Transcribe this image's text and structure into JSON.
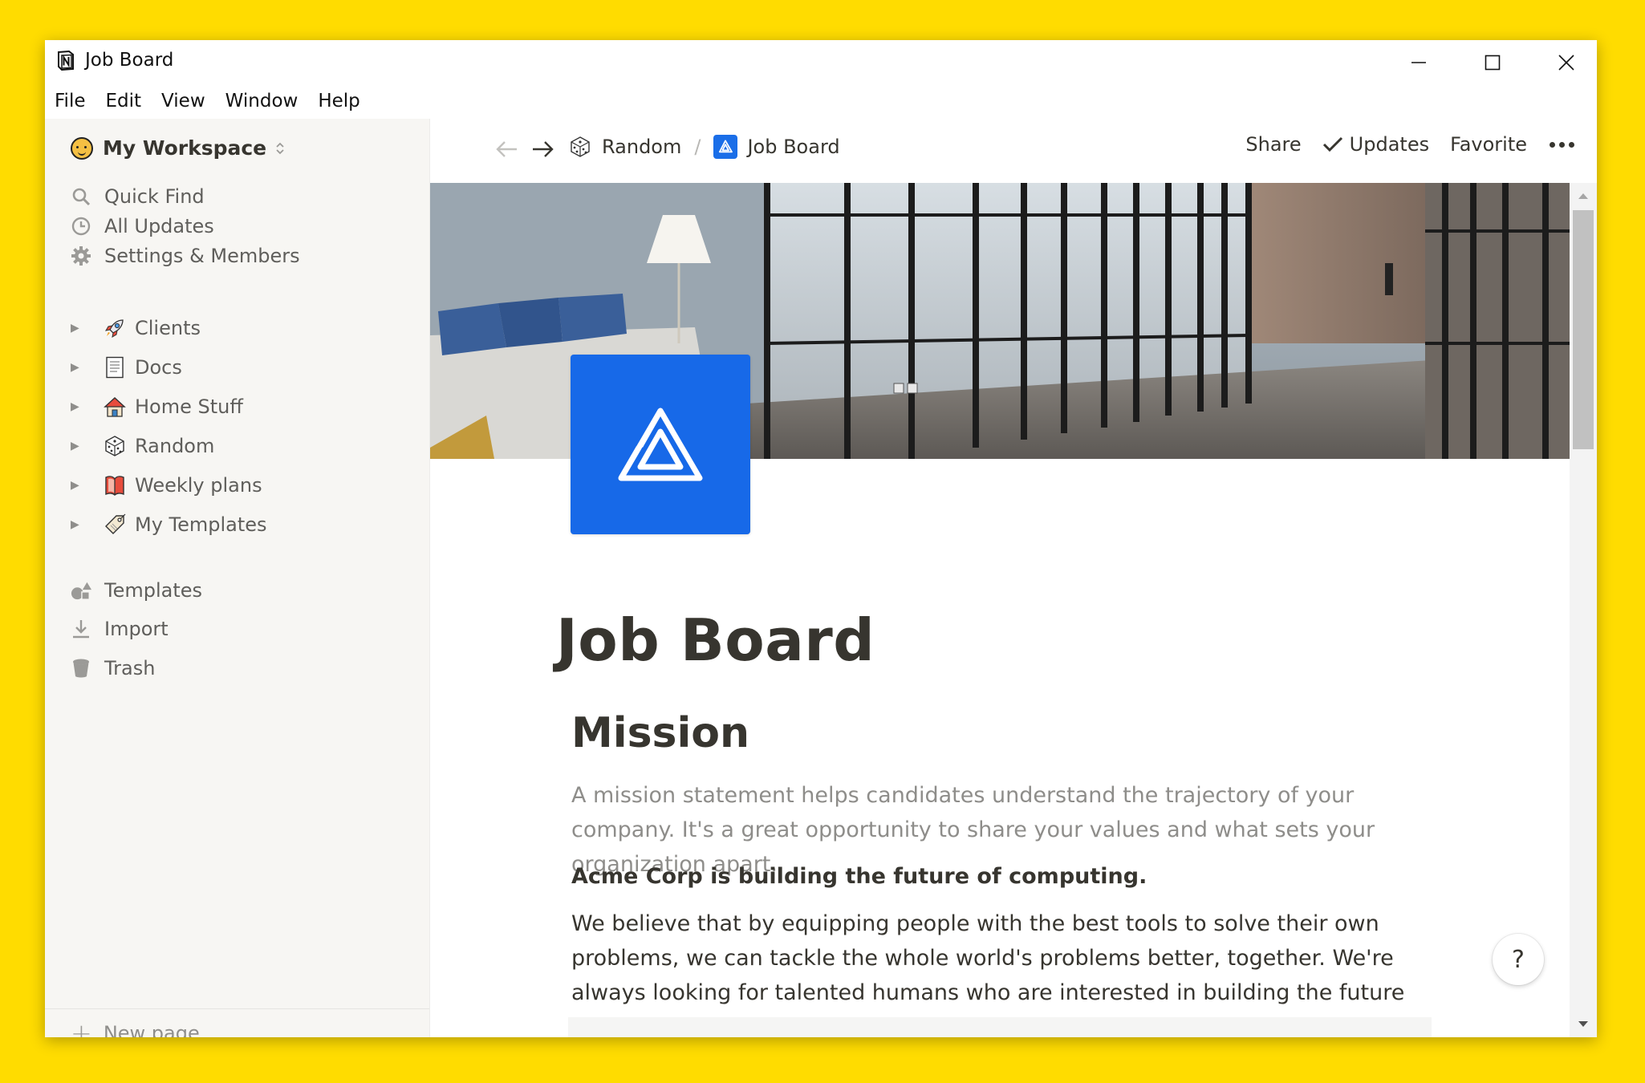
{
  "window": {
    "title": "Job Board"
  },
  "menu": [
    "File",
    "Edit",
    "View",
    "Window",
    "Help"
  ],
  "sidebar": {
    "workspace": "My Workspace",
    "nav": [
      {
        "label": "Quick Find",
        "icon": "search-icon"
      },
      {
        "label": "All Updates",
        "icon": "clock-icon"
      },
      {
        "label": "Settings & Members",
        "icon": "gear-icon"
      }
    ],
    "pages": [
      {
        "label": "Clients",
        "icon": "rocket-icon"
      },
      {
        "label": "Docs",
        "icon": "document-icon"
      },
      {
        "label": "Home Stuff",
        "icon": "house-icon"
      },
      {
        "label": "Random",
        "icon": "dice-icon"
      },
      {
        "label": "Weekly plans",
        "icon": "notebook-icon"
      },
      {
        "label": "My Templates",
        "icon": "tag-icon"
      }
    ],
    "tools": [
      {
        "label": "Templates",
        "icon": "shapes-icon"
      },
      {
        "label": "Import",
        "icon": "download-icon"
      },
      {
        "label": "Trash",
        "icon": "trash-icon"
      }
    ],
    "new_page": "New page"
  },
  "topbar": {
    "breadcrumbs": [
      "Random",
      "Job Board"
    ],
    "separator": "/",
    "share": "Share",
    "updates": "Updates",
    "favorite": "Favorite"
  },
  "page": {
    "title": "Job Board",
    "heading": "Mission",
    "hint": "A mission statement helps candidates understand the trajectory of your company. It's a great opportunity to share your values and what sets your organization apart.",
    "bold_line": "Acme Corp is building the future of computing.",
    "body": "We believe that by equipping people with the best tools to solve their own problems, we can tackle the whole world's problems better, together. We're always looking for talented humans who are interested in building the future alongside us."
  },
  "help": {
    "label": "?"
  },
  "colors": {
    "background": "#FFDC00",
    "sidebar": "#f7f6f3",
    "accent": "#1769e8",
    "text": "#37352f",
    "muted": "#8e8d8a"
  }
}
